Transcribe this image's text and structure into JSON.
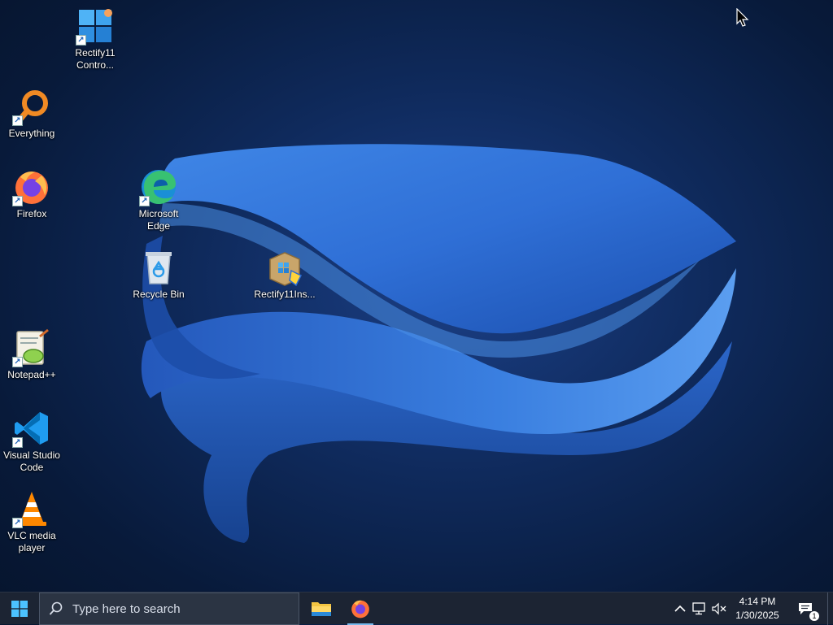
{
  "desktop": {
    "icons": [
      {
        "label": "Rectify11\nContro...",
        "icon": "rectify11-control-panel-icon",
        "shortcut": true
      },
      {
        "label": "Everything",
        "icon": "everything-search-icon",
        "shortcut": true
      },
      {
        "label": "Firefox",
        "icon": "firefox-icon",
        "shortcut": true
      },
      {
        "label": "Microsoft\nEdge",
        "icon": "edge-icon",
        "shortcut": true
      },
      {
        "label": "Recycle Bin",
        "icon": "recycle-bin-icon",
        "shortcut": false
      },
      {
        "label": "Rectify11Ins...",
        "icon": "installer-package-icon",
        "shortcut": false
      },
      {
        "label": "Notepad++",
        "icon": "notepad-plus-plus-icon",
        "shortcut": true
      },
      {
        "label": "Visual Studio\nCode",
        "icon": "vscode-icon",
        "shortcut": true
      },
      {
        "label": "VLC media\nplayer",
        "icon": "vlc-icon",
        "shortcut": true
      }
    ]
  },
  "taskbar": {
    "start_icon": "windows-logo-icon",
    "search_placeholder": "Type here to search",
    "pinned": [
      {
        "name": "File Explorer",
        "icon": "folder-icon",
        "active": false
      },
      {
        "name": "Firefox",
        "icon": "firefox-icon",
        "active": true
      }
    ],
    "tray": {
      "chevron_icon": "chevron-up-icon",
      "network_icon": "network-icon",
      "volume_icon": "volume-muted-icon",
      "time": "4:14 PM",
      "date": "1/30/2025",
      "notification_count": "1"
    }
  },
  "colors": {
    "wallpaper_dark": "#06142c",
    "wallpaper_bloom": "#2f6fd6",
    "taskbar_bg": "#1c2433",
    "accent": "#76b9ed"
  }
}
